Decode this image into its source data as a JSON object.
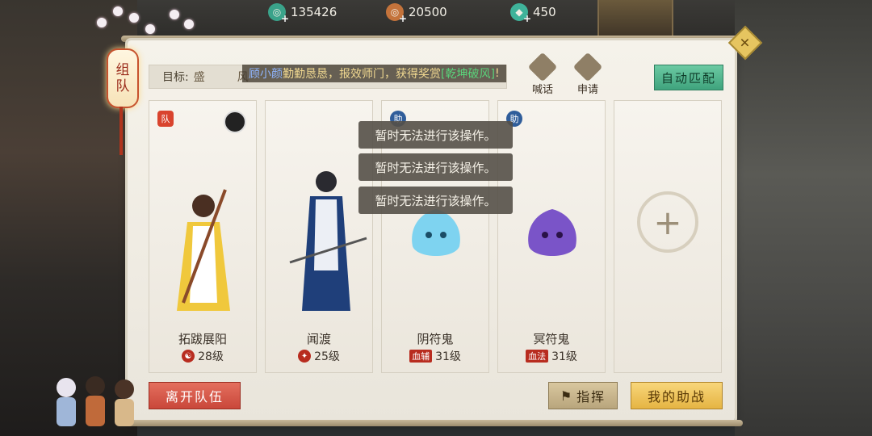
{
  "currency": [
    {
      "icon": "jade-coin-icon",
      "value": "135426",
      "color": "#3aa38a"
    },
    {
      "icon": "copper-coin-icon",
      "value": "20500",
      "color": "#c4733b"
    },
    {
      "icon": "green-gem-icon",
      "value": "450",
      "color": "#3fb39a"
    }
  ],
  "tab": {
    "label_line1": "组",
    "label_line2": "队"
  },
  "target": {
    "label": "目标:",
    "value": "盛",
    "value2": "风"
  },
  "system_message": {
    "name": "顾小颜",
    "text": "勤勤恳恳，报效师门，获得奖赏",
    "item": "[乾坤破风]",
    "end": "!"
  },
  "header_actions": [
    {
      "label": "喊话",
      "icon": "shout-icon"
    },
    {
      "label": "申请",
      "icon": "apply-icon"
    }
  ],
  "auto_match_label": "自动匹配",
  "members": [
    {
      "name": "拓跋展阳",
      "level": "28级",
      "badge": "队",
      "level_icon": "yin-yang-icon"
    },
    {
      "name": "闻渡",
      "level": "25级",
      "badge": "",
      "level_icon": "wolf-emblem-icon"
    },
    {
      "name": "阴符鬼",
      "level": "31级",
      "badge": "助",
      "level_tag": "血辅"
    },
    {
      "name": "冥符鬼",
      "level": "31级",
      "badge": "助",
      "level_tag": "血法"
    }
  ],
  "toasts": [
    "暂时无法进行该操作。",
    "暂时无法进行该操作。",
    "暂时无法进行该操作。"
  ],
  "buttons": {
    "leave": "离开队伍",
    "command": "指挥",
    "assist": "我的助战"
  }
}
